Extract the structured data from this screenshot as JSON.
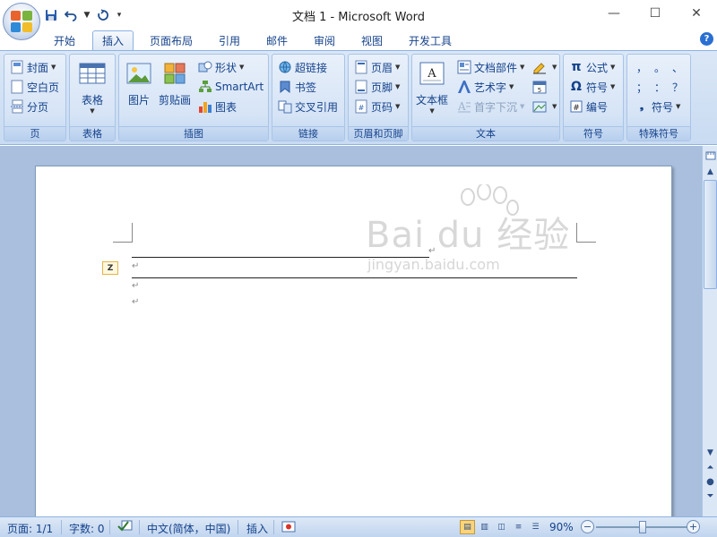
{
  "window": {
    "title": "文档 1 - Microsoft Word",
    "controls": {
      "minimize": "—",
      "maximize": "☐",
      "close": "✕"
    }
  },
  "quick_access": {
    "icons": [
      "save-icon",
      "undo-icon",
      "redo-icon",
      "customize-icon"
    ]
  },
  "tabs": [
    {
      "label": "开始",
      "active": false
    },
    {
      "label": "插入",
      "active": true
    },
    {
      "label": "页面布局",
      "active": false
    },
    {
      "label": "引用",
      "active": false
    },
    {
      "label": "邮件",
      "active": false
    },
    {
      "label": "审阅",
      "active": false
    },
    {
      "label": "视图",
      "active": false
    },
    {
      "label": "开发工具",
      "active": false
    }
  ],
  "ribbon": {
    "groups": {
      "pages": {
        "label": "页",
        "items": [
          "封面",
          "空白页",
          "分页"
        ]
      },
      "tables": {
        "label": "表格",
        "button": "表格"
      },
      "illustrations": {
        "label": "插图",
        "picture": "图片",
        "clipart": "剪贴画",
        "shapes": "形状",
        "smartart": "SmartArt",
        "chart": "图表"
      },
      "links": {
        "label": "链接",
        "items": [
          "超链接",
          "书签",
          "交叉引用"
        ]
      },
      "header_footer": {
        "label": "页眉和页脚",
        "items": [
          "页眉",
          "页脚",
          "页码"
        ]
      },
      "text": {
        "label": "文本",
        "textbox": "文本框",
        "quickparts": "文档部件",
        "wordart": "艺术字",
        "dropcap": "首字下沉"
      },
      "symbols": {
        "label": "符号",
        "items": [
          "公式",
          "符号",
          "编号"
        ]
      },
      "special": {
        "label": "特殊符号",
        "glyphs": [
          "，",
          "。",
          "、",
          "；",
          "：",
          "？"
        ],
        "button": "符号"
      }
    }
  },
  "document": {
    "watermark_brand": "Bai du 经验",
    "watermark_url": "jingyan.baidu.com",
    "para_mark": "↵"
  },
  "status": {
    "page": "页面: 1/1",
    "words": "字数: 0",
    "language": "中文(简体，中国)",
    "mode": "插入",
    "zoom": "90%",
    "zoom_level_fraction": 0.5
  }
}
